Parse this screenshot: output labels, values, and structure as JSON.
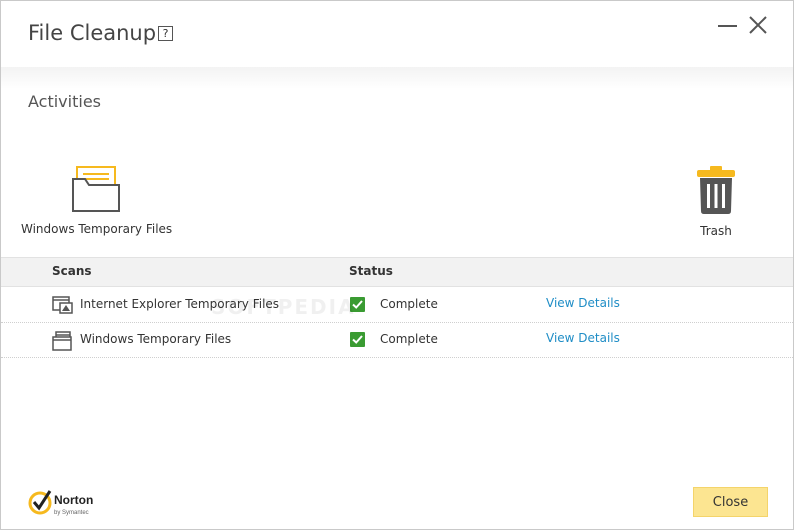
{
  "window": {
    "title": "File Cleanup",
    "help_glyph": "?",
    "minimize_icon": "minimize-icon",
    "close_icon": "close-icon"
  },
  "activities": {
    "label": "Activities",
    "items": [
      {
        "label": "Windows Temporary Files",
        "icon": "folder-icon"
      },
      {
        "label": "Trash",
        "icon": "trash-icon"
      }
    ]
  },
  "table": {
    "headers": {
      "scans": "Scans",
      "status": "Status"
    },
    "rows": [
      {
        "name": "Internet Explorer Temporary Files",
        "status": "Complete",
        "link": "View Details",
        "icon": "browser-files-icon"
      },
      {
        "name": "Windows Temporary Files",
        "status": "Complete",
        "link": "View Details",
        "icon": "window-files-icon"
      }
    ]
  },
  "watermark": "SOFTPEDIA",
  "footer": {
    "brand": "Norton",
    "brand_sub": "by Symantec",
    "close_label": "Close"
  },
  "colors": {
    "accent_yellow": "#fce591",
    "folder_yellow": "#f6b91e",
    "check_green": "#3a9b32",
    "link_blue": "#1f8dc6"
  }
}
